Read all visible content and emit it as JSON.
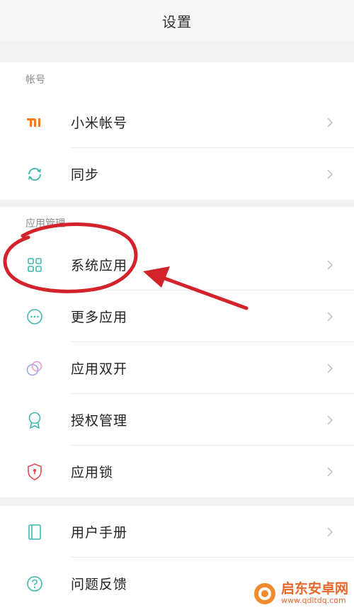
{
  "header": {
    "title": "设置"
  },
  "sections": [
    {
      "title": "帐号",
      "items": [
        {
          "label": "小米帐号",
          "icon": "mi-logo-icon"
        },
        {
          "label": "同步",
          "icon": "sync-icon"
        }
      ]
    },
    {
      "title": "应用管理",
      "items": [
        {
          "label": "系统应用",
          "icon": "grid-icon"
        },
        {
          "label": "更多应用",
          "icon": "more-dots-icon"
        },
        {
          "label": "应用双开",
          "icon": "dual-app-icon"
        },
        {
          "label": "授权管理",
          "icon": "badge-icon"
        },
        {
          "label": "应用锁",
          "icon": "shield-lock-icon"
        }
      ]
    },
    {
      "title": "",
      "items": [
        {
          "label": "用户手册",
          "icon": "book-icon"
        },
        {
          "label": "问题反馈",
          "icon": "question-icon"
        }
      ]
    }
  ],
  "watermark": {
    "name": "启东安卓网",
    "url": "www.qdltdq.com"
  },
  "colors": {
    "accent": "#3fb9b0",
    "mi": "#f47b20",
    "annotation": "#d3232a",
    "shield": "#e04b5a"
  }
}
